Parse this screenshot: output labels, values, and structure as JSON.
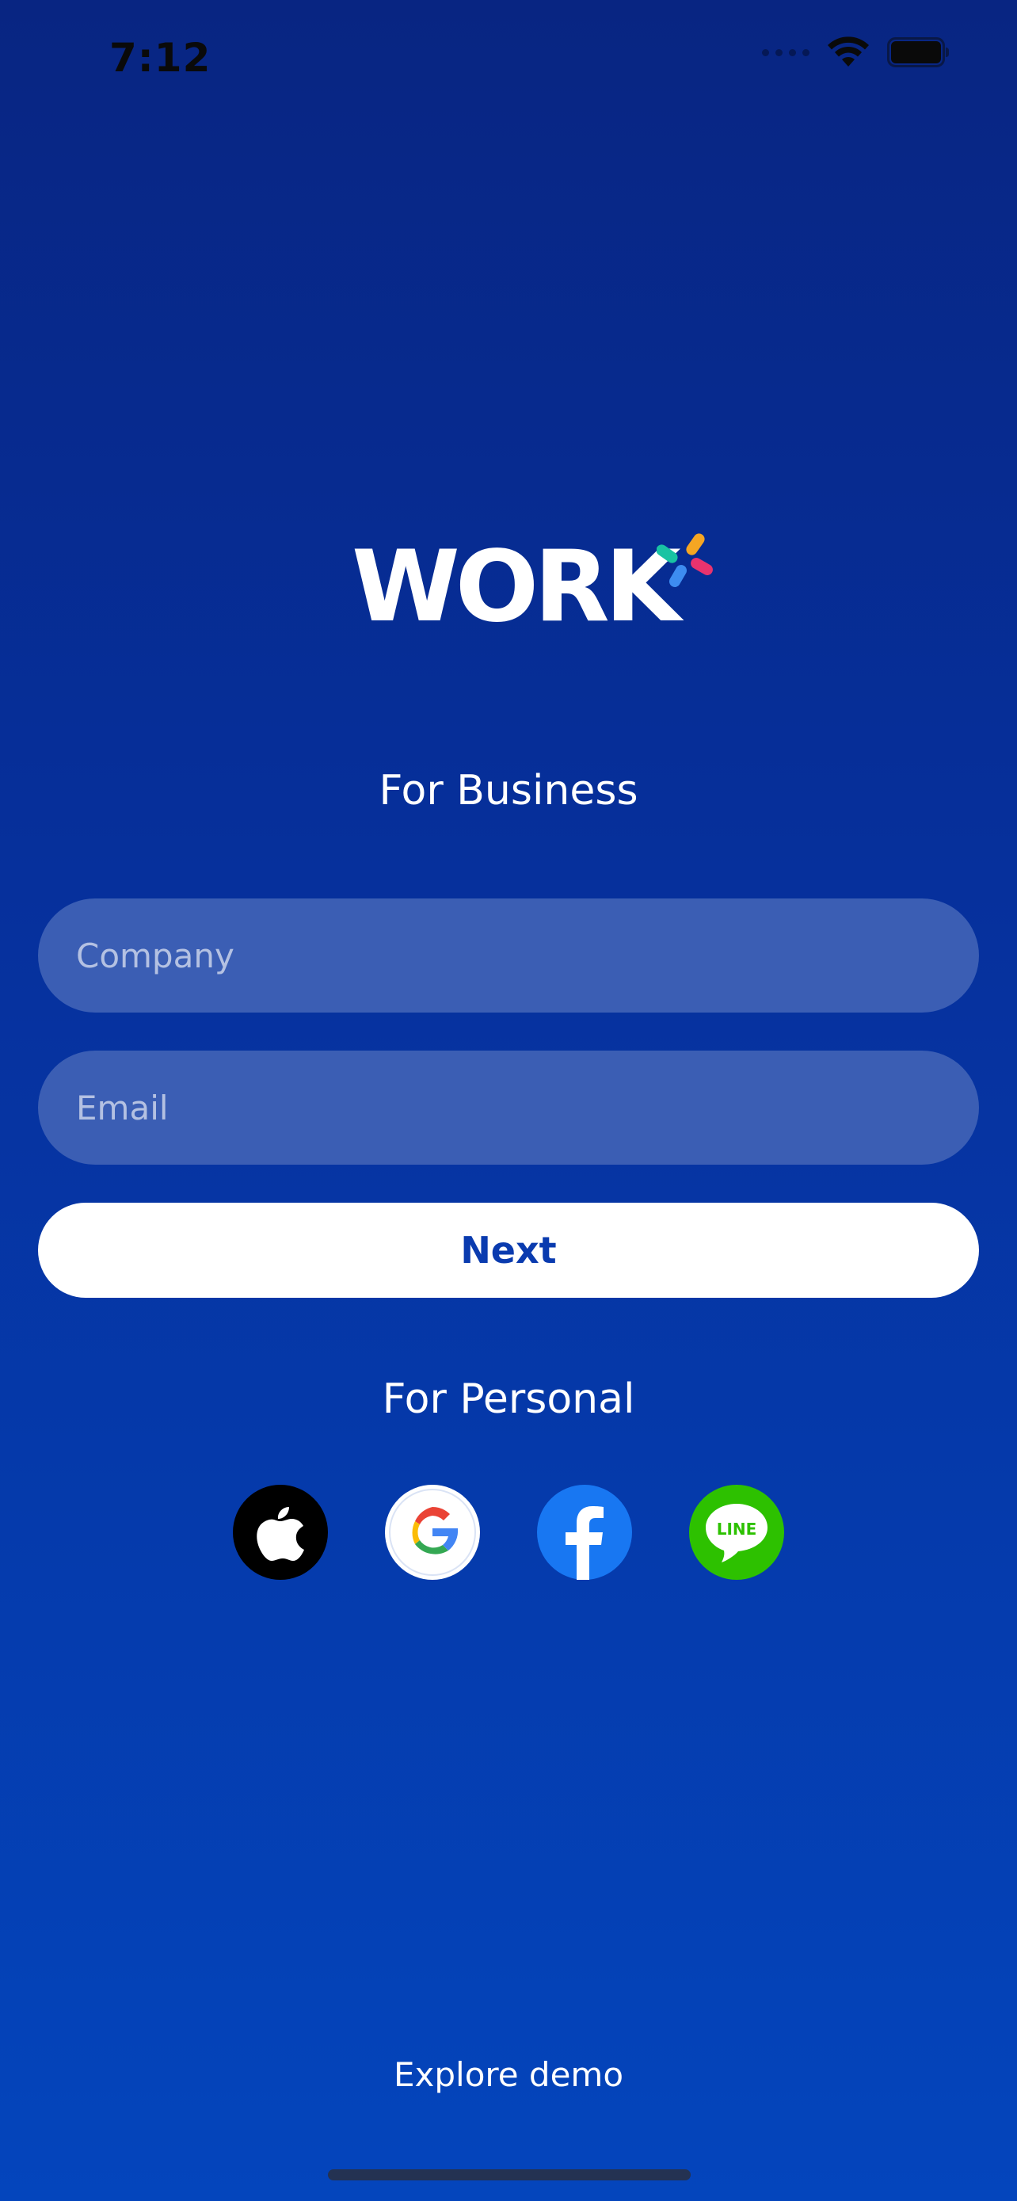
{
  "status_bar": {
    "time": "7:12",
    "icons": [
      "signal-icon",
      "wifi-icon",
      "battery-icon"
    ]
  },
  "logo": {
    "text": "WORK",
    "mark_colors": [
      "#F5A623",
      "#19C3A3",
      "#E8336E",
      "#3D8CF0"
    ]
  },
  "business": {
    "title": "For Business",
    "company_placeholder": "Company",
    "email_placeholder": "Email",
    "next_label": "Next"
  },
  "personal": {
    "title": "For Personal",
    "providers": [
      {
        "name": "apple-icon",
        "color": "#000000"
      },
      {
        "name": "google-icon",
        "color": "#FFFFFF"
      },
      {
        "name": "facebook-icon",
        "color": "#1877F2"
      },
      {
        "name": "line-icon",
        "color": "#2DC100",
        "label": "LINE"
      }
    ]
  },
  "footer": {
    "explore_label": "Explore demo"
  },
  "colors": {
    "background_top": "#082582",
    "background_bottom": "#0445BC",
    "field_bg": "#3B5EB4",
    "button_text": "#0A3BAF"
  }
}
